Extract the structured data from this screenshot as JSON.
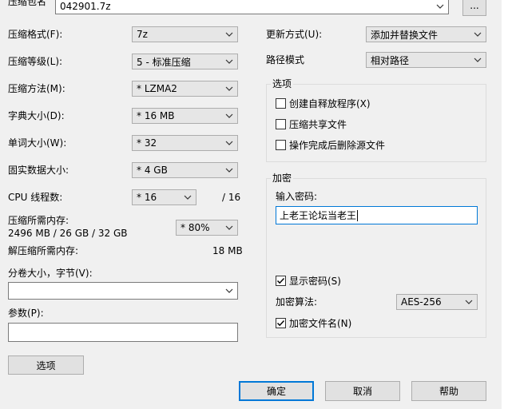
{
  "archive": {
    "label": "压缩包名",
    "path": "042901.7z",
    "browse_label": "..."
  },
  "left": {
    "format": {
      "label": "压缩格式(F):",
      "value": "7z"
    },
    "level": {
      "label": "压缩等级(L):",
      "value": "5 - 标准压缩"
    },
    "method": {
      "label": "压缩方法(M):",
      "value": "* LZMA2"
    },
    "dict": {
      "label": "字典大小(D):",
      "value": "* 16 MB"
    },
    "word": {
      "label": "单词大小(W):",
      "value": "* 32"
    },
    "solid": {
      "label": "固实数据大小:",
      "value": "* 4 GB"
    },
    "threads": {
      "label": "CPU 线程数:",
      "value": "* 16",
      "max": "/ 16"
    },
    "mem_compress": {
      "label": "压缩所需内存:",
      "value": "2496 MB / 26 GB / 32 GB",
      "percent": "* 80%"
    },
    "mem_decompress": {
      "label": "解压缩所需内存:",
      "value": "18 MB"
    },
    "volume": {
      "label": "分卷大小，字节(V):",
      "value": ""
    },
    "params": {
      "label": "参数(P):",
      "value": ""
    },
    "options_button": "选项"
  },
  "right": {
    "update_mode": {
      "label": "更新方式(U):",
      "value": "添加并替换文件"
    },
    "path_mode": {
      "label": "路径模式",
      "value": "相对路径"
    },
    "options_group": {
      "title": "选项",
      "sfx": {
        "label": "创建自释放程序(X)",
        "checked": false
      },
      "shared": {
        "label": "压缩共享文件",
        "checked": false
      },
      "delete": {
        "label": "操作完成后删除源文件",
        "checked": false
      }
    },
    "encryption_group": {
      "title": "加密",
      "password_label": "输入密码:",
      "password_value": "上老王论坛当老王",
      "show_password": {
        "label": "显示密码(S)",
        "checked": true
      },
      "method_label": "加密算法:",
      "method_value": "AES-256",
      "encrypt_names": {
        "label": "加密文件名(N)",
        "checked": true
      }
    }
  },
  "buttons": {
    "ok": "确定",
    "cancel": "取消",
    "help": "帮助"
  }
}
